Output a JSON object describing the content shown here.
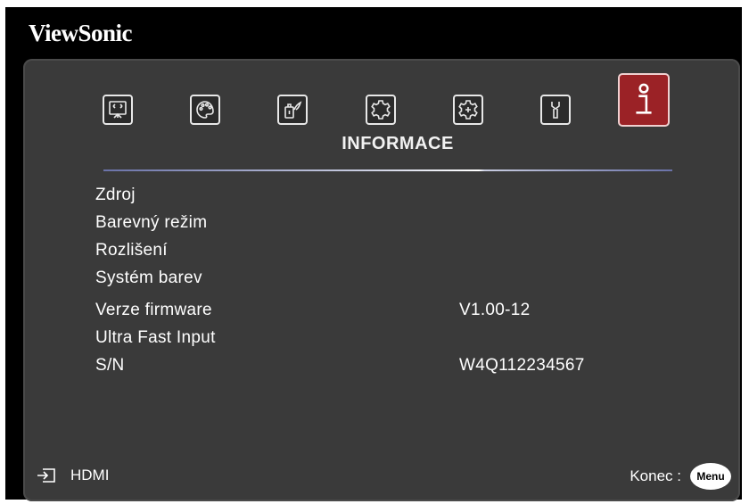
{
  "brand": "ViewSonic",
  "tabs": [
    {
      "icon": "display-icon"
    },
    {
      "icon": "palette-icon"
    },
    {
      "icon": "power-eco-icon"
    },
    {
      "icon": "gear-icon"
    },
    {
      "icon": "advanced-gear-icon"
    },
    {
      "icon": "wrench-icon"
    },
    {
      "icon": "info-icon",
      "active": true
    }
  ],
  "section_title": "INFORMACE",
  "info_rows": [
    {
      "label": "Zdroj",
      "value": ""
    },
    {
      "label": "Barevný režim",
      "value": ""
    },
    {
      "label": "Rozlišení",
      "value": ""
    },
    {
      "label": "Systém barev",
      "value": ""
    },
    {
      "label": "Verze firmware",
      "value": "V1.00-12"
    },
    {
      "label": "Ultra Fast Input",
      "value": ""
    },
    {
      "label": "S/N",
      "value": "W4Q112234567"
    }
  ],
  "footer": {
    "source": "HDMI",
    "exit_label": "Konec :",
    "menu_button": "Menu"
  },
  "colors": {
    "panel": "#3a3a3a",
    "active_tab": "#9b2226",
    "text": "#ffffff"
  }
}
